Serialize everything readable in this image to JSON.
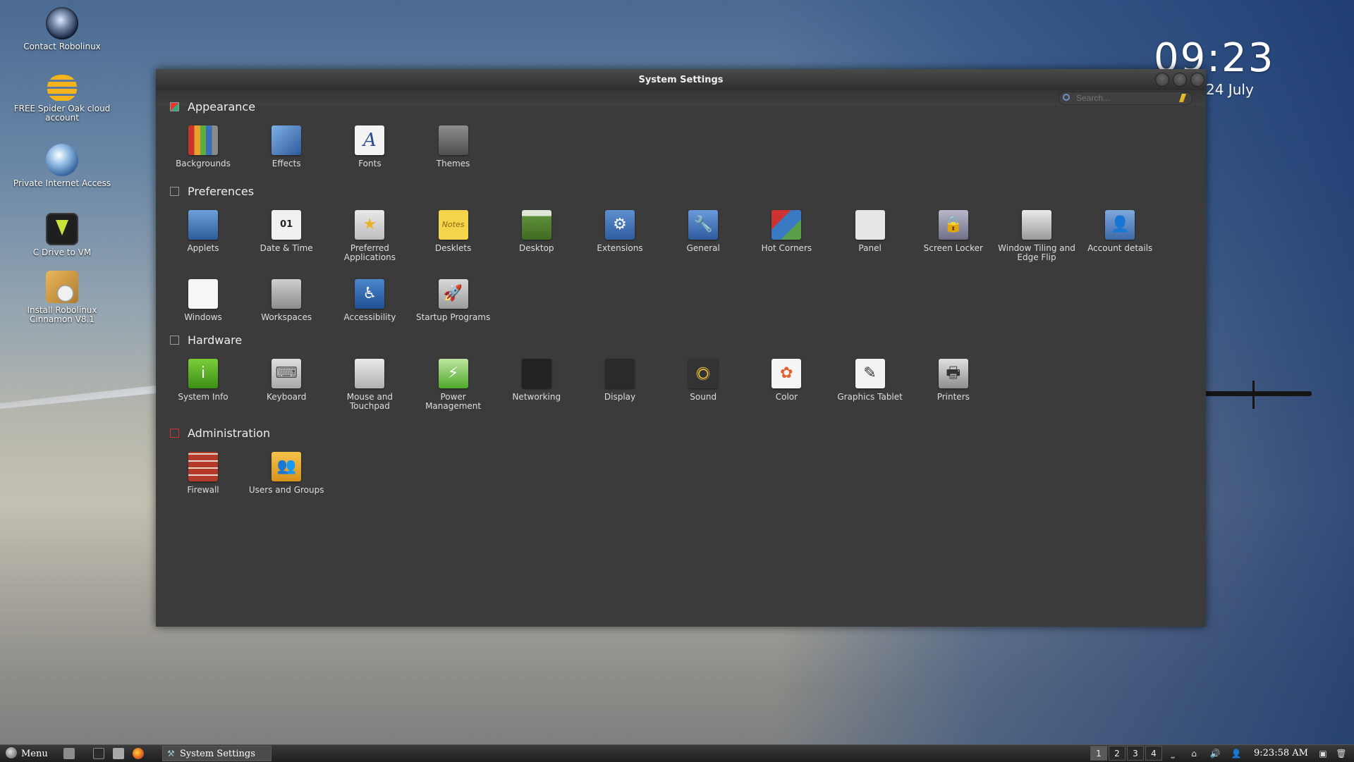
{
  "desktop": {
    "icons": [
      {
        "label": "Contact Robolinux",
        "icon": "contact-robolinux-icon"
      },
      {
        "label": "FREE Spider Oak cloud account",
        "icon": "spideroak-icon"
      },
      {
        "label": "Private Internet Access",
        "icon": "pia-icon"
      },
      {
        "label": "C Drive to VM",
        "icon": "download-arrow-icon"
      },
      {
        "label": "Install Robolinux Cinnamon V8.1",
        "icon": "installer-icon"
      }
    ],
    "clock": {
      "time": "09:23",
      "date": "24 July"
    }
  },
  "window": {
    "title": "System Settings",
    "search": {
      "placeholder": "Search..."
    },
    "sections": [
      {
        "title": "Appearance",
        "items": [
          {
            "label": "Backgrounds",
            "icon": "backgrounds-icon"
          },
          {
            "label": "Effects",
            "icon": "effects-icon"
          },
          {
            "label": "Fonts",
            "icon": "fonts-icon",
            "glyph": "A"
          },
          {
            "label": "Themes",
            "icon": "themes-icon"
          }
        ]
      },
      {
        "title": "Preferences",
        "items": [
          {
            "label": "Applets",
            "icon": "applets-icon"
          },
          {
            "label": "Date & Time",
            "icon": "date-time-icon",
            "glyph": "01"
          },
          {
            "label": "Preferred Applications",
            "icon": "preferred-applications-icon",
            "glyph": "★"
          },
          {
            "label": "Desklets",
            "icon": "desklets-icon",
            "glyph": "Notes"
          },
          {
            "label": "Desktop",
            "icon": "desktop-icon"
          },
          {
            "label": "Extensions",
            "icon": "extensions-icon",
            "glyph": "⚙"
          },
          {
            "label": "General",
            "icon": "general-icon",
            "glyph": "🔧"
          },
          {
            "label": "Hot Corners",
            "icon": "hot-corners-icon"
          },
          {
            "label": "Panel",
            "icon": "panel-icon"
          },
          {
            "label": "Screen Locker",
            "icon": "screen-locker-icon",
            "glyph": "🔒"
          },
          {
            "label": "Window Tiling and Edge Flip",
            "icon": "window-tiling-icon"
          },
          {
            "label": "Account details",
            "icon": "account-details-icon",
            "glyph": "👤"
          },
          {
            "label": "Windows",
            "icon": "windows-icon"
          },
          {
            "label": "Workspaces",
            "icon": "workspaces-icon"
          },
          {
            "label": "Accessibility",
            "icon": "accessibility-icon",
            "glyph": "♿"
          },
          {
            "label": "Startup Programs",
            "icon": "startup-programs-icon",
            "glyph": "🚀"
          }
        ]
      },
      {
        "title": "Hardware",
        "items": [
          {
            "label": "System Info",
            "icon": "system-info-icon",
            "glyph": "i"
          },
          {
            "label": "Keyboard",
            "icon": "keyboard-icon",
            "glyph": "⌨"
          },
          {
            "label": "Mouse and Touchpad",
            "icon": "mouse-icon"
          },
          {
            "label": "Power Management",
            "icon": "power-management-icon",
            "glyph": "⚡"
          },
          {
            "label": "Networking",
            "icon": "networking-icon"
          },
          {
            "label": "Display",
            "icon": "display-icon"
          },
          {
            "label": "Sound",
            "icon": "sound-icon",
            "glyph": "◉"
          },
          {
            "label": "Color",
            "icon": "color-icon",
            "glyph": "✿"
          },
          {
            "label": "Graphics Tablet",
            "icon": "graphics-tablet-icon",
            "glyph": "✎"
          },
          {
            "label": "Printers",
            "icon": "printers-icon",
            "glyph": "🖶"
          }
        ]
      },
      {
        "title": "Administration",
        "items": [
          {
            "label": "Firewall",
            "icon": "firewall-icon"
          },
          {
            "label": "Users and Groups",
            "icon": "users-groups-icon",
            "glyph": "👥"
          }
        ]
      }
    ]
  },
  "taskbar": {
    "menu_label": "Menu",
    "task_label": "System Settings",
    "workspaces": [
      "1",
      "2",
      "3",
      "4"
    ],
    "active_workspace": "1",
    "clock": "9:23:58 AM"
  },
  "colors": {
    "window_bg": "#3b3b3b",
    "text": "#dddddd",
    "accent_blue": "#3f6ea8"
  }
}
